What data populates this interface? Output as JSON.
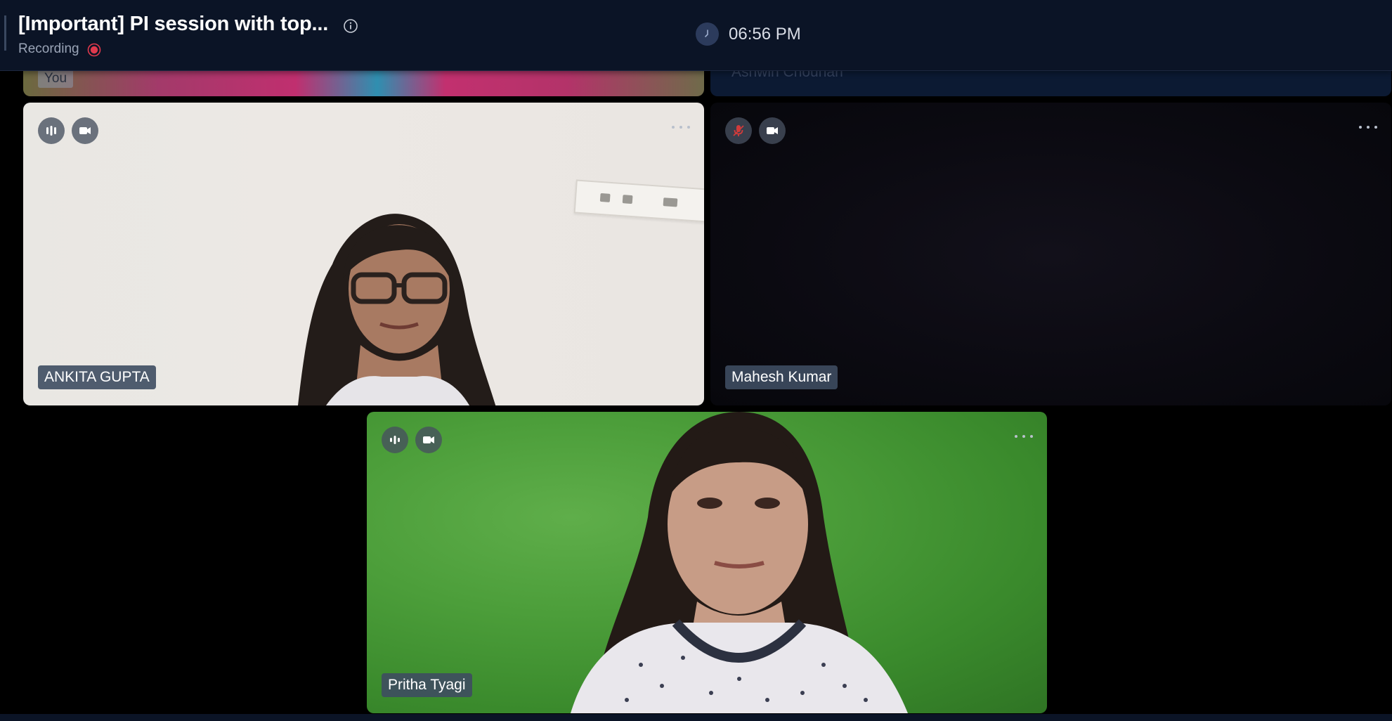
{
  "header": {
    "meeting_title": "[Important] PI session with top...",
    "recording_label": "Recording",
    "time": "06:56 PM"
  },
  "icons": {
    "info": "info-icon",
    "recording": "record-dot-icon",
    "clock": "clock-icon",
    "audio": "audio-level-icon",
    "video": "video-camera-icon",
    "mic_off": "mic-muted-icon",
    "more": "more-options-icon"
  },
  "colors": {
    "header_bg": "#0b1426",
    "name_tag_bg": "#3e4c60",
    "recording_red": "#e0394d",
    "muted_red": "#d13b3b"
  },
  "participants": {
    "you": {
      "name": "You"
    },
    "ashwin": {
      "name": "Ashwin Chouhan"
    },
    "ankita": {
      "name": "ANKITA GUPTA",
      "mic": "on",
      "camera": "on"
    },
    "mahesh": {
      "name": "Mahesh Kumar",
      "mic": "muted",
      "camera": "on"
    },
    "pritha": {
      "name": "Pritha Tyagi",
      "mic": "on",
      "camera": "on"
    }
  }
}
